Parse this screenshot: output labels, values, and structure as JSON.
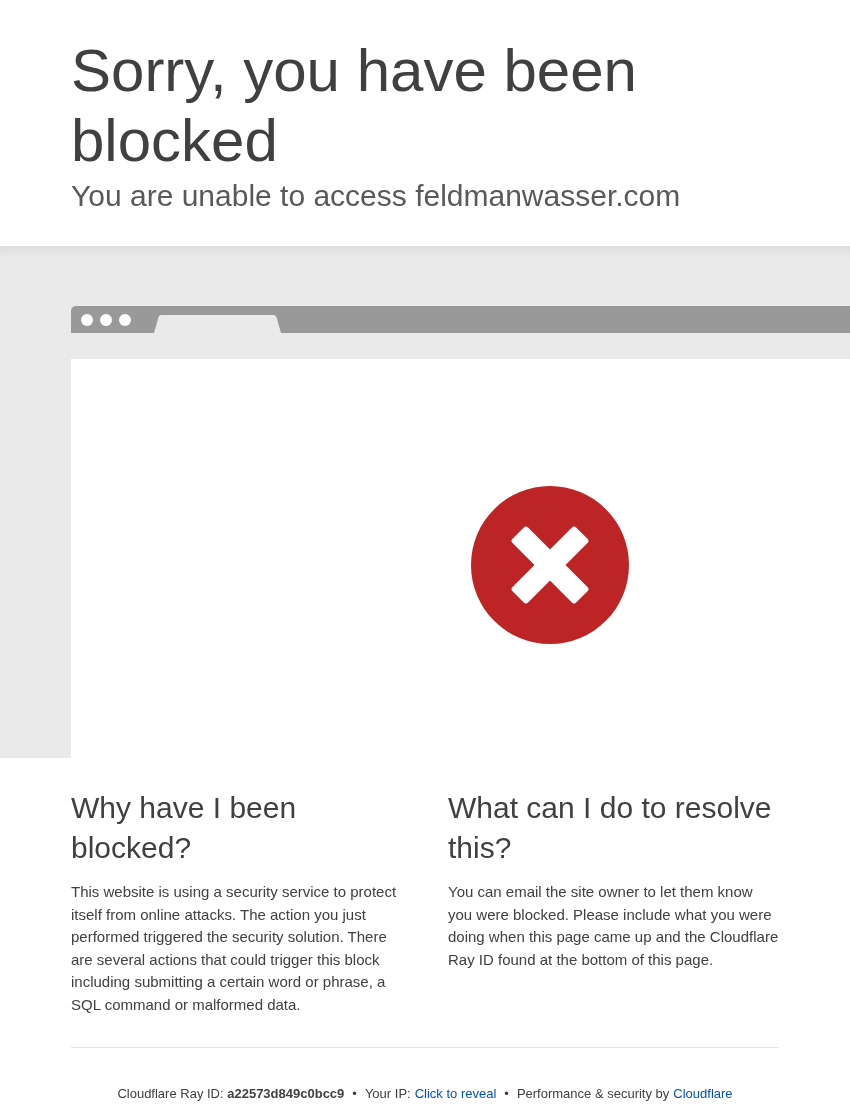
{
  "header": {
    "title": "Sorry, you have been blocked",
    "subtitle": "You are unable to access feldmanwasser.com"
  },
  "sections": [
    {
      "heading": "Why have I been blocked?",
      "body": "This website is using a security service to protect itself from online attacks. The action you just performed triggered the security solution. There are several actions that could trigger this block including submitting a certain word or phrase, a SQL command or malformed data."
    },
    {
      "heading": "What can I do to resolve this?",
      "body": "You can email the site owner to let them know you were blocked. Please include what you were doing when this page came up and the Cloudflare Ray ID found at the bottom of this page."
    }
  ],
  "footer": [
    {
      "kind": "text",
      "text": "Cloudflare Ray ID: **a22573d849c0bcc9**"
    },
    {
      "kind": "separator",
      "text": "•"
    },
    {
      "kind": "text",
      "text": "Your IP:"
    },
    {
      "kind": "link",
      "text": "Click to reveal"
    },
    {
      "kind": "separator",
      "text": "•"
    },
    {
      "kind": "text",
      "text": "Performance & security by"
    },
    {
      "kind": "link",
      "text": "Cloudflare"
    }
  ]
}
